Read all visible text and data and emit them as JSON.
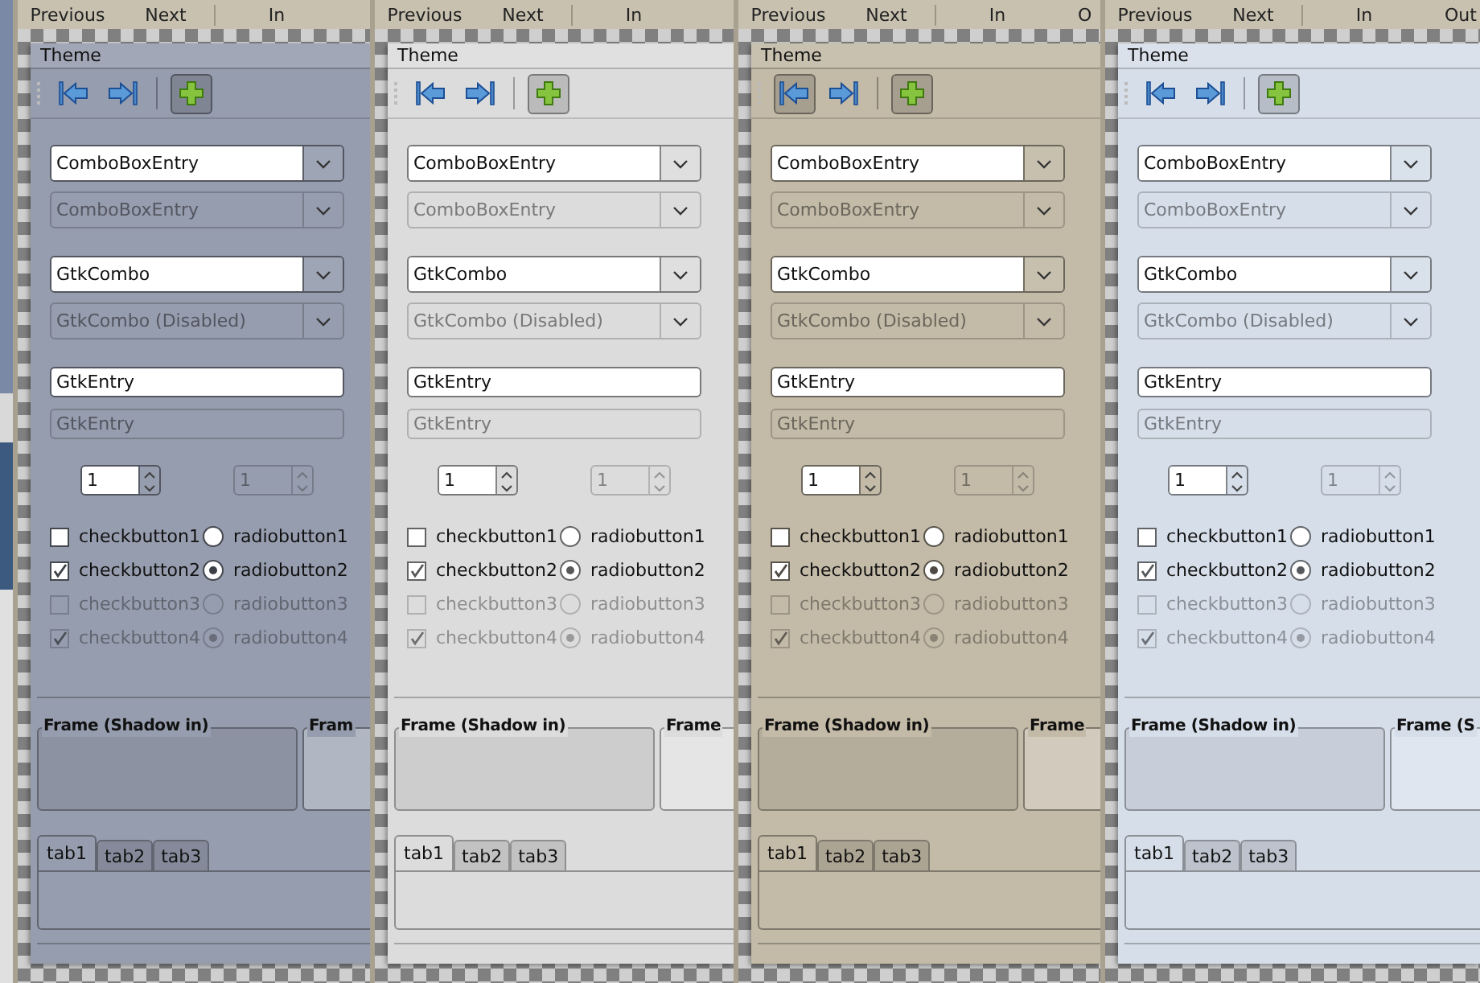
{
  "panels": [
    {
      "color": "#969dae",
      "top_bar": [
        "Previous",
        "Next",
        "In"
      ],
      "title": "Theme",
      "toolbar": [
        {
          "kind": "back",
          "pressed": false
        },
        {
          "kind": "forward",
          "pressed": false
        },
        {
          "kind": "separator"
        },
        {
          "kind": "add",
          "pressed": true
        }
      ],
      "combo_box_entries": [
        {
          "value": "ComboBoxEntry",
          "disabled": false
        },
        {
          "value": "ComboBoxEntry",
          "disabled": true
        }
      ],
      "gtk_combos": [
        {
          "value": "GtkCombo",
          "disabled": false
        },
        {
          "value": "GtkCombo (Disabled)",
          "disabled": true
        }
      ],
      "entries": [
        {
          "value": "GtkEntry",
          "disabled": false
        },
        {
          "value": "GtkEntry",
          "disabled": true
        }
      ],
      "spin_buttons": [
        {
          "value": "1",
          "disabled": false
        },
        {
          "value": "1",
          "disabled": true
        }
      ],
      "check_buttons": [
        {
          "label": "checkbutton1",
          "checked": false,
          "disabled": false
        },
        {
          "label": "checkbutton2",
          "checked": true,
          "disabled": false
        },
        {
          "label": "checkbutton3",
          "checked": false,
          "disabled": true
        },
        {
          "label": "checkbutton4",
          "checked": true,
          "disabled": true
        }
      ],
      "radio_buttons": [
        {
          "label": "radiobutton1",
          "selected": false,
          "disabled": false
        },
        {
          "label": "radiobutton2",
          "selected": true,
          "disabled": false
        },
        {
          "label": "radiobutton3",
          "selected": false,
          "disabled": true
        },
        {
          "label": "radiobutton4",
          "selected": true,
          "disabled": true
        }
      ],
      "frames": [
        "Frame (Shadow in)",
        "Fram"
      ],
      "tabs": [
        {
          "label": "tab1",
          "selected": true
        },
        {
          "label": "tab2",
          "selected": false
        },
        {
          "label": "tab3",
          "selected": false
        }
      ]
    },
    {
      "color": "#dcdcdc",
      "top_bar": [
        "Previous",
        "Next",
        "In"
      ],
      "title": "Theme",
      "toolbar": [
        {
          "kind": "back",
          "pressed": false
        },
        {
          "kind": "forward",
          "pressed": false
        },
        {
          "kind": "separator"
        },
        {
          "kind": "add",
          "pressed": true
        }
      ],
      "combo_box_entries": [
        {
          "value": "ComboBoxEntry",
          "disabled": false
        },
        {
          "value": "ComboBoxEntry",
          "disabled": true
        }
      ],
      "gtk_combos": [
        {
          "value": "GtkCombo",
          "disabled": false
        },
        {
          "value": "GtkCombo (Disabled)",
          "disabled": true
        }
      ],
      "entries": [
        {
          "value": "GtkEntry",
          "disabled": false
        },
        {
          "value": "GtkEntry",
          "disabled": true
        }
      ],
      "spin_buttons": [
        {
          "value": "1",
          "disabled": false
        },
        {
          "value": "1",
          "disabled": true
        }
      ],
      "check_buttons": [
        {
          "label": "checkbutton1",
          "checked": false,
          "disabled": false
        },
        {
          "label": "checkbutton2",
          "checked": true,
          "disabled": false
        },
        {
          "label": "checkbutton3",
          "checked": false,
          "disabled": true
        },
        {
          "label": "checkbutton4",
          "checked": true,
          "disabled": true
        }
      ],
      "radio_buttons": [
        {
          "label": "radiobutton1",
          "selected": false,
          "disabled": false
        },
        {
          "label": "radiobutton2",
          "selected": true,
          "disabled": false
        },
        {
          "label": "radiobutton3",
          "selected": false,
          "disabled": true
        },
        {
          "label": "radiobutton4",
          "selected": true,
          "disabled": true
        }
      ],
      "frames": [
        "Frame (Shadow in)",
        "Frame"
      ],
      "tabs": [
        {
          "label": "tab1",
          "selected": true
        },
        {
          "label": "tab2",
          "selected": false
        },
        {
          "label": "tab3",
          "selected": false
        }
      ]
    },
    {
      "color": "#c3baa7",
      "top_bar": [
        "Previous",
        "Next",
        "In",
        "O"
      ],
      "title": "Theme",
      "toolbar": [
        {
          "kind": "back",
          "pressed": true
        },
        {
          "kind": "forward",
          "pressed": false
        },
        {
          "kind": "separator"
        },
        {
          "kind": "add",
          "pressed": true
        }
      ],
      "combo_box_entries": [
        {
          "value": "ComboBoxEntry",
          "disabled": false
        },
        {
          "value": "ComboBoxEntry",
          "disabled": true
        }
      ],
      "gtk_combos": [
        {
          "value": "GtkCombo",
          "disabled": false
        },
        {
          "value": "GtkCombo (Disabled)",
          "disabled": true
        }
      ],
      "entries": [
        {
          "value": "GtkEntry",
          "disabled": false
        },
        {
          "value": "GtkEntry",
          "disabled": true
        }
      ],
      "spin_buttons": [
        {
          "value": "1",
          "disabled": false
        },
        {
          "value": "1",
          "disabled": true
        }
      ],
      "check_buttons": [
        {
          "label": "checkbutton1",
          "checked": false,
          "disabled": false
        },
        {
          "label": "checkbutton2",
          "checked": true,
          "disabled": false
        },
        {
          "label": "checkbutton3",
          "checked": false,
          "disabled": true
        },
        {
          "label": "checkbutton4",
          "checked": true,
          "disabled": true
        }
      ],
      "radio_buttons": [
        {
          "label": "radiobutton1",
          "selected": false,
          "disabled": false
        },
        {
          "label": "radiobutton2",
          "selected": true,
          "disabled": false
        },
        {
          "label": "radiobutton3",
          "selected": false,
          "disabled": true
        },
        {
          "label": "radiobutton4",
          "selected": true,
          "disabled": true
        }
      ],
      "frames": [
        "Frame (Shadow in)",
        "Frame"
      ],
      "tabs": [
        {
          "label": "tab1",
          "selected": true
        },
        {
          "label": "tab2",
          "selected": false
        },
        {
          "label": "tab3",
          "selected": false
        }
      ]
    },
    {
      "color": "#d6dee9",
      "top_bar": [
        "Previous",
        "Next",
        "In",
        "Out"
      ],
      "title": "Theme",
      "toolbar": [
        {
          "kind": "back",
          "pressed": false
        },
        {
          "kind": "forward",
          "pressed": false
        },
        {
          "kind": "separator"
        },
        {
          "kind": "add",
          "pressed": true
        }
      ],
      "combo_box_entries": [
        {
          "value": "ComboBoxEntry",
          "disabled": false
        },
        {
          "value": "ComboBoxEntry",
          "disabled": true
        }
      ],
      "gtk_combos": [
        {
          "value": "GtkCombo",
          "disabled": false
        },
        {
          "value": "GtkCombo (Disabled)",
          "disabled": true
        }
      ],
      "entries": [
        {
          "value": "GtkEntry",
          "disabled": false
        },
        {
          "value": "GtkEntry",
          "disabled": true
        }
      ],
      "spin_buttons": [
        {
          "value": "1",
          "disabled": false
        },
        {
          "value": "1",
          "disabled": true
        }
      ],
      "check_buttons": [
        {
          "label": "checkbutton1",
          "checked": false,
          "disabled": false
        },
        {
          "label": "checkbutton2",
          "checked": true,
          "disabled": false
        },
        {
          "label": "checkbutton3",
          "checked": false,
          "disabled": true
        },
        {
          "label": "checkbutton4",
          "checked": true,
          "disabled": true
        }
      ],
      "radio_buttons": [
        {
          "label": "radiobutton1",
          "selected": false,
          "disabled": false
        },
        {
          "label": "radiobutton2",
          "selected": true,
          "disabled": false
        },
        {
          "label": "radiobutton3",
          "selected": false,
          "disabled": true
        },
        {
          "label": "radiobutton4",
          "selected": true,
          "disabled": true
        }
      ],
      "frames": [
        "Frame (Shadow in)",
        "Frame (S"
      ],
      "tabs": [
        {
          "label": "tab1",
          "selected": true
        },
        {
          "label": "tab2",
          "selected": false
        },
        {
          "label": "tab3",
          "selected": false
        }
      ]
    }
  ]
}
